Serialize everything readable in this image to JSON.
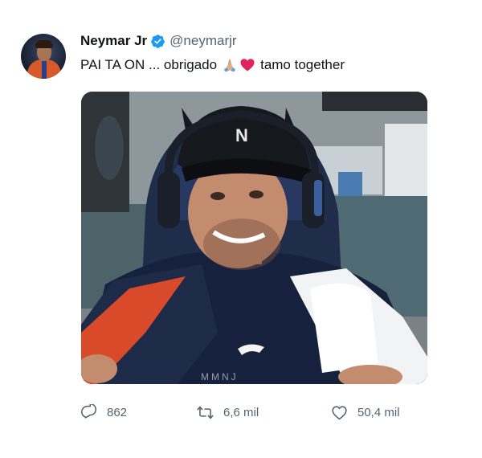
{
  "tweet": {
    "author_name": "Neymar Jr",
    "handle": "@neymarjr",
    "text_part1": "PAI TA ON ... obrigado",
    "text_part2": "tamo together",
    "emojis": [
      "folded-hands-emoji",
      "red-heart-emoji"
    ],
    "media_watermark": "MMNJ",
    "colors": {
      "verified": "#1d9bf0",
      "heart_emoji": "#e0245e",
      "text": "#0f1419",
      "secondary": "#536471"
    }
  },
  "actions": {
    "reply_count": "862",
    "retweet_count": "6,6 mil",
    "like_count": "50,4 mil"
  }
}
